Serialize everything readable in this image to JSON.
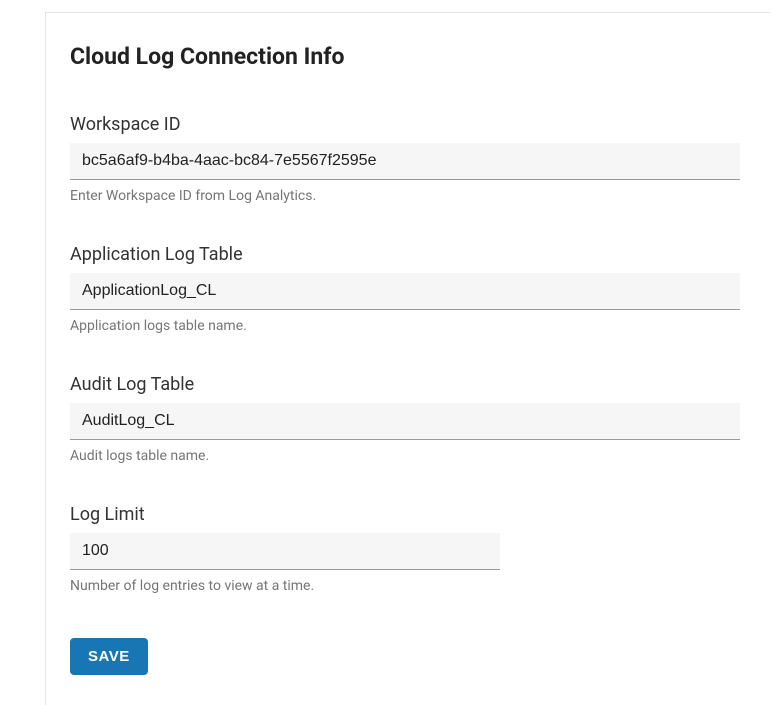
{
  "title": "Cloud Log Connection Info",
  "fields": {
    "workspace_id": {
      "label": "Workspace ID",
      "value": "bc5a6af9-b4ba-4aac-bc84-7e5567f2595e",
      "help": "Enter Workspace ID from Log Analytics."
    },
    "app_log_table": {
      "label": "Application Log Table",
      "value": "ApplicationLog_CL",
      "help": "Application logs table name."
    },
    "audit_log_table": {
      "label": "Audit Log Table",
      "value": "AuditLog_CL",
      "help": "Audit logs table name."
    },
    "log_limit": {
      "label": "Log Limit",
      "value": "100",
      "help": "Number of log entries to view at a time."
    }
  },
  "actions": {
    "save_label": "SAVE"
  }
}
